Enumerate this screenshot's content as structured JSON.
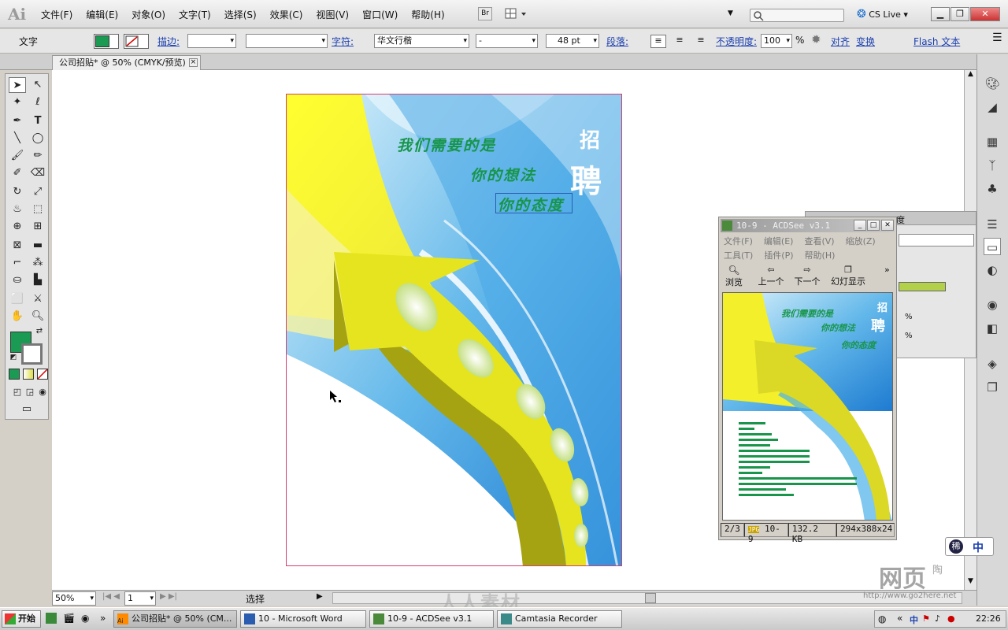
{
  "app": {
    "logo": "Ai",
    "menus": [
      "文件(F)",
      "编辑(E)",
      "对象(O)",
      "文字(T)",
      "选择(S)",
      "效果(C)",
      "视图(V)",
      "窗口(W)",
      "帮助(H)"
    ],
    "bridge": "Br",
    "cs_live": "CS Live"
  },
  "control": {
    "mode": "文字",
    "stroke_label": "描边:",
    "char_label": "字符:",
    "font": "华文行楷",
    "style": "-",
    "size": "48 pt",
    "para_label": "段落:",
    "opacity_label": "不透明度:",
    "opacity": "100",
    "pct": "%",
    "align": "对齐",
    "transform": "变换",
    "flash_text": "Flash 文本"
  },
  "tab": {
    "title": "公司招贴* @ 50% (CMYK/预览)",
    "close": "×"
  },
  "poster": {
    "zhao": "招",
    "pin": "聘",
    "line1": "我们需要的是",
    "line2": "你的想法",
    "line3": "你的态度"
  },
  "status": {
    "zoom": "50%",
    "page": "1",
    "mode": "选择"
  },
  "acdsee": {
    "title": "10-9 - ACDSee v3.1",
    "menu1": [
      "文件(F)",
      "编辑(E)",
      "查看(V)",
      "缩放(Z)"
    ],
    "menu2": [
      "工具(T)",
      "插件(P)",
      "帮助(H)"
    ],
    "btn_browse": "浏览",
    "btn_prev": "上一个",
    "btn_next": "下一个",
    "btn_slide": "幻灯显示",
    "status": [
      "2/3",
      "10-9",
      "132.2 KB",
      "294x388x24"
    ],
    "thumb_line1": "我们需要的是",
    "thumb_line2": "你的想法",
    "thumb_line3": "你的态度",
    "thumb_zhao": "招",
    "thumb_pin": "聘",
    "bg_label": "度",
    "pct": "%"
  },
  "taskbar": {
    "start": "开始",
    "tasks": [
      "公司招贴* @ 50% (CM...",
      "10 - Microsoft Word",
      "10-9 - ACDSee v3.1",
      "Camtasia Recorder"
    ],
    "clock": "22:26",
    "ime": "中"
  },
  "watermark": {
    "site": "网页",
    "site2": "陶",
    "url": "http://www.go2here.net",
    "center": "人人素材"
  }
}
